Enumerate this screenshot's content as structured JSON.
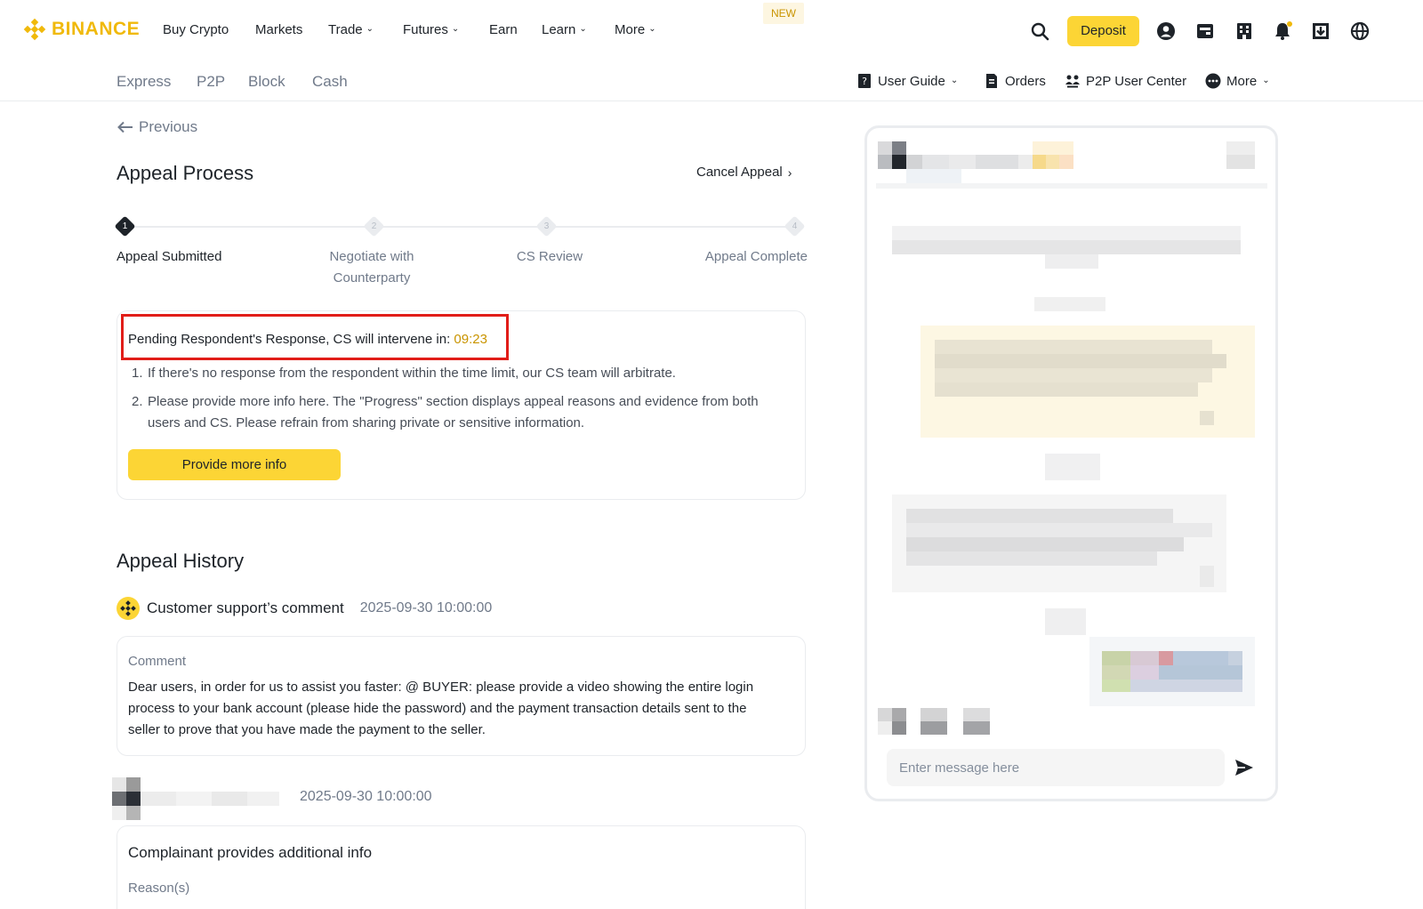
{
  "brand": {
    "name": "BINANCE",
    "accent": "#f0b90b",
    "button_yellow": "#fcd535"
  },
  "topnav": {
    "items": [
      {
        "label": "Buy Crypto",
        "has_chevron": false
      },
      {
        "label": "Markets",
        "has_chevron": false
      },
      {
        "label": "Trade",
        "has_chevron": true
      },
      {
        "label": "Futures",
        "has_chevron": true
      },
      {
        "label": "Earn",
        "has_chevron": false
      },
      {
        "label": "Learn",
        "has_chevron": true
      },
      {
        "label": "More",
        "has_chevron": true
      }
    ],
    "new_badge": "NEW",
    "deposit_label": "Deposit",
    "icons": [
      "search-icon",
      "user-icon",
      "wallet-icon",
      "orders-icon",
      "notification-bell-icon",
      "download-icon",
      "globe-icon"
    ]
  },
  "subnav": {
    "left": [
      "Express",
      "P2P",
      "Block",
      "Cash"
    ],
    "user_guide": "User Guide",
    "orders": "Orders",
    "p2p_user_center": "P2P User Center",
    "more": "More"
  },
  "appeal": {
    "previous_label": "Previous",
    "title": "Appeal Process",
    "cancel_label": "Cancel Appeal",
    "steps": [
      {
        "number": "1",
        "label": "Appeal Submitted",
        "active": true
      },
      {
        "number": "2",
        "label": "Negotiate with Counterparty",
        "active": false
      },
      {
        "number": "3",
        "label": "CS Review",
        "active": false
      },
      {
        "number": "4",
        "label": "Appeal Complete",
        "active": false
      }
    ],
    "pending_text": "Pending Respondent's Response, CS will intervene in: ",
    "timer": "09:23",
    "info": [
      {
        "num": "1.",
        "text": "If there's no response from the respondent within the time limit, our CS team will arbitrate."
      },
      {
        "num": "2.",
        "text": "Please provide more info here. The \"Progress\" section displays appeal reasons and evidence from both users and CS. Please refrain from sharing private or sensitive information."
      }
    ],
    "provide_more_info_label": "Provide more info"
  },
  "history": {
    "title": "Appeal History",
    "cs_comment": {
      "author": "Customer support’s comment",
      "time": "2025-09-30 10:00:00",
      "label": "Comment",
      "body": "Dear users, in order for us to assist you faster: @ BUYER: please provide a video showing the entire login process to your bank account (please hide the password) and the payment transaction details sent to the seller to prove that you have made the payment to the seller."
    },
    "user_entry": {
      "time": "2025-09-30 10:00:00",
      "title": "Complainant provides additional info",
      "reasons_label": "Reason(s)"
    }
  },
  "chat": {
    "input_placeholder": "Enter message here"
  }
}
